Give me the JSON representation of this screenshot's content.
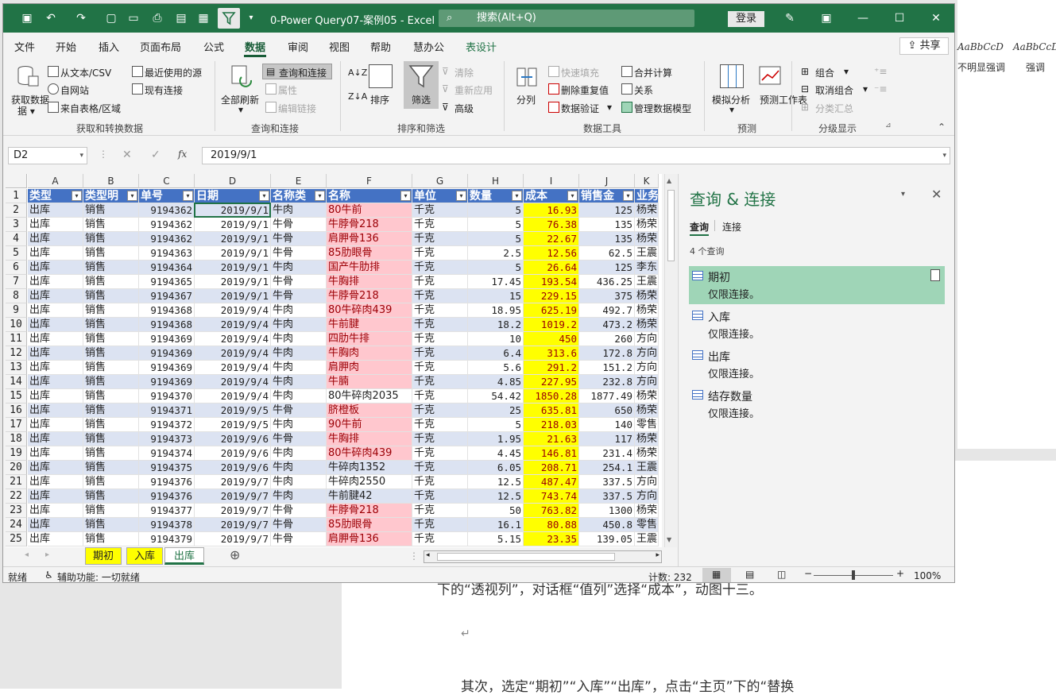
{
  "word": {
    "line1": "下的“透视列”，对话框“值列”选择“成本”，动图十三。",
    "para_mark": "↵",
    "line2": "其次，选定“期初”“入库”“出库”，点击“主页”下的“替换",
    "style1_preview": "AaBbCcD",
    "style1_name": "不明显强调",
    "style2_preview": "AaBbCcD",
    "style2_name": "强调"
  },
  "titlebar": {
    "doc_title": "0-Power Query07-案例05  -  Excel",
    "search_placeholder": "搜索(Alt+Q)",
    "login": "登录"
  },
  "menu": {
    "items": [
      "文件",
      "开始",
      "插入",
      "页面布局",
      "公式",
      "数据",
      "审阅",
      "视图",
      "帮助",
      "慧办公",
      "表设计"
    ],
    "active": "数据",
    "share": "共享"
  },
  "ribbon": {
    "get_data": "获取数据",
    "from_text": "从文本/CSV",
    "from_web": "自网站",
    "from_table": "来自表格/区域",
    "recent_sources": "最近使用的源",
    "existing_conn": "现有连接",
    "group1": "获取和转换数据",
    "refresh_all": "全部刷新",
    "queries_conn": "查询和连接",
    "properties": "属性",
    "edit_links": "编辑链接",
    "group2": "查询和连接",
    "sort": "排序",
    "filter": "筛选",
    "clear": "清除",
    "reapply": "重新应用",
    "advanced": "高级",
    "group3": "排序和筛选",
    "split": "分列",
    "flash_fill": "快速填充",
    "remove_dup": "删除重复值",
    "data_valid": "数据验证",
    "consolidate": "合并计算",
    "relations": "关系",
    "manage_model": "管理数据模型",
    "group4": "数据工具",
    "whatif": "模拟分析",
    "forecast_sheet": "预测工作表",
    "group5": "预测",
    "group_btn": "组合",
    "ungroup": "取消组合",
    "subtotal": "分类汇总",
    "group6": "分级显示"
  },
  "formula": {
    "namebox": "D2",
    "value": "2019/9/1"
  },
  "columns": [
    "A",
    "B",
    "C",
    "D",
    "E",
    "F",
    "G",
    "H",
    "I",
    "J",
    "K"
  ],
  "headers": [
    "类型",
    "类型明",
    "单号",
    "日期",
    "名称类",
    "名称",
    "单位",
    "数量",
    "成本",
    "销售金",
    "业务"
  ],
  "rows": [
    [
      "2",
      "出库",
      "销售",
      "9194362",
      "2019/9/1",
      "牛肉",
      "80牛前",
      "千克",
      "5",
      "16.93",
      "125",
      "杨荣"
    ],
    [
      "3",
      "出库",
      "销售",
      "9194362",
      "2019/9/1",
      "牛骨",
      "牛脖骨218",
      "千克",
      "5",
      "76.38",
      "135",
      "杨荣"
    ],
    [
      "4",
      "出库",
      "销售",
      "9194362",
      "2019/9/1",
      "牛骨",
      "肩胛骨136",
      "千克",
      "5",
      "22.67",
      "135",
      "杨荣"
    ],
    [
      "5",
      "出库",
      "销售",
      "9194363",
      "2019/9/1",
      "牛骨",
      "85肋眼骨",
      "千克",
      "2.5",
      "12.56",
      "62.5",
      "王震"
    ],
    [
      "6",
      "出库",
      "销售",
      "9194364",
      "2019/9/1",
      "牛肉",
      "国产牛肋排",
      "千克",
      "5",
      "26.64",
      "125",
      "李东"
    ],
    [
      "7",
      "出库",
      "销售",
      "9194365",
      "2019/9/1",
      "牛骨",
      "牛胸排",
      "千克",
      "17.45",
      "193.54",
      "436.25",
      "王震"
    ],
    [
      "8",
      "出库",
      "销售",
      "9194367",
      "2019/9/1",
      "牛骨",
      "牛脖骨218",
      "千克",
      "15",
      "229.15",
      "375",
      "杨荣"
    ],
    [
      "9",
      "出库",
      "销售",
      "9194368",
      "2019/9/4",
      "牛肉",
      "80牛碎肉439",
      "千克",
      "18.95",
      "625.19",
      "492.7",
      "杨荣"
    ],
    [
      "10",
      "出库",
      "销售",
      "9194368",
      "2019/9/4",
      "牛肉",
      "牛前腱",
      "千克",
      "18.2",
      "1019.2",
      "473.2",
      "杨荣"
    ],
    [
      "11",
      "出库",
      "销售",
      "9194369",
      "2019/9/4",
      "牛肉",
      "四肋牛排",
      "千克",
      "10",
      "450",
      "260",
      "方向"
    ],
    [
      "12",
      "出库",
      "销售",
      "9194369",
      "2019/9/4",
      "牛肉",
      "牛胸肉",
      "千克",
      "6.4",
      "313.6",
      "172.8",
      "方向"
    ],
    [
      "13",
      "出库",
      "销售",
      "9194369",
      "2019/9/4",
      "牛肉",
      "肩胛肉",
      "千克",
      "5.6",
      "291.2",
      "151.2",
      "方向"
    ],
    [
      "14",
      "出库",
      "销售",
      "9194369",
      "2019/9/4",
      "牛肉",
      "牛腩",
      "千克",
      "4.85",
      "227.95",
      "232.8",
      "方向"
    ],
    [
      "15",
      "出库",
      "销售",
      "9194370",
      "2019/9/4",
      "牛肉",
      "80牛碎肉2035",
      "千克",
      "54.42",
      "1850.28",
      "1877.49",
      "杨荣"
    ],
    [
      "16",
      "出库",
      "销售",
      "9194371",
      "2019/9/5",
      "牛骨",
      "脐橙板",
      "千克",
      "25",
      "635.81",
      "650",
      "杨荣"
    ],
    [
      "17",
      "出库",
      "销售",
      "9194372",
      "2019/9/5",
      "牛肉",
      "90牛前",
      "千克",
      "5",
      "218.03",
      "140",
      "零售"
    ],
    [
      "18",
      "出库",
      "销售",
      "9194373",
      "2019/9/6",
      "牛骨",
      "牛胸排",
      "千克",
      "1.95",
      "21.63",
      "117",
      "杨荣"
    ],
    [
      "19",
      "出库",
      "销售",
      "9194374",
      "2019/9/6",
      "牛肉",
      "80牛碎肉439",
      "千克",
      "4.45",
      "146.81",
      "231.4",
      "杨荣"
    ],
    [
      "20",
      "出库",
      "销售",
      "9194375",
      "2019/9/6",
      "牛肉",
      "牛碎肉1352",
      "千克",
      "6.05",
      "208.71",
      "254.1",
      "王震"
    ],
    [
      "21",
      "出库",
      "销售",
      "9194376",
      "2019/9/7",
      "牛肉",
      "牛碎肉2550",
      "千克",
      "12.5",
      "487.47",
      "337.5",
      "方向"
    ],
    [
      "22",
      "出库",
      "销售",
      "9194376",
      "2019/9/7",
      "牛肉",
      "牛前腱42",
      "千克",
      "12.5",
      "743.74",
      "337.5",
      "方向"
    ],
    [
      "23",
      "出库",
      "销售",
      "9194377",
      "2019/9/7",
      "牛骨",
      "牛脖骨218",
      "千克",
      "50",
      "763.82",
      "1300",
      "杨荣"
    ],
    [
      "24",
      "出库",
      "销售",
      "9194378",
      "2019/9/7",
      "牛骨",
      "85肋眼骨",
      "千克",
      "16.1",
      "80.88",
      "450.8",
      "零售"
    ],
    [
      "25",
      "出库",
      "销售",
      "9194379",
      "2019/9/7",
      "牛骨",
      "肩胛骨136",
      "千克",
      "5.15",
      "23.35",
      "139.05",
      "王震"
    ]
  ],
  "pink_rows": [
    "2",
    "3",
    "4",
    "5",
    "6",
    "7",
    "8",
    "9",
    "10",
    "11",
    "12",
    "13",
    "14",
    "16",
    "17",
    "18",
    "19",
    "23",
    "24",
    "25"
  ],
  "sheets": [
    "期初",
    "入库",
    "出库"
  ],
  "active_sheet": "出库",
  "status": {
    "ready": "就绪",
    "accessibility": "辅助功能: 一切就绪",
    "count": "计数: 232",
    "zoom": "100%"
  },
  "query_pane": {
    "title": "查询 & 连接",
    "tab_queries": "查询",
    "tab_connections": "连接",
    "count": "4 个查询",
    "items": [
      {
        "name": "期初",
        "desc": "仅限连接。"
      },
      {
        "name": "入库",
        "desc": "仅限连接。"
      },
      {
        "name": "出库",
        "desc": "仅限连接。"
      },
      {
        "name": "结存数量",
        "desc": "仅限连接。"
      }
    ]
  }
}
